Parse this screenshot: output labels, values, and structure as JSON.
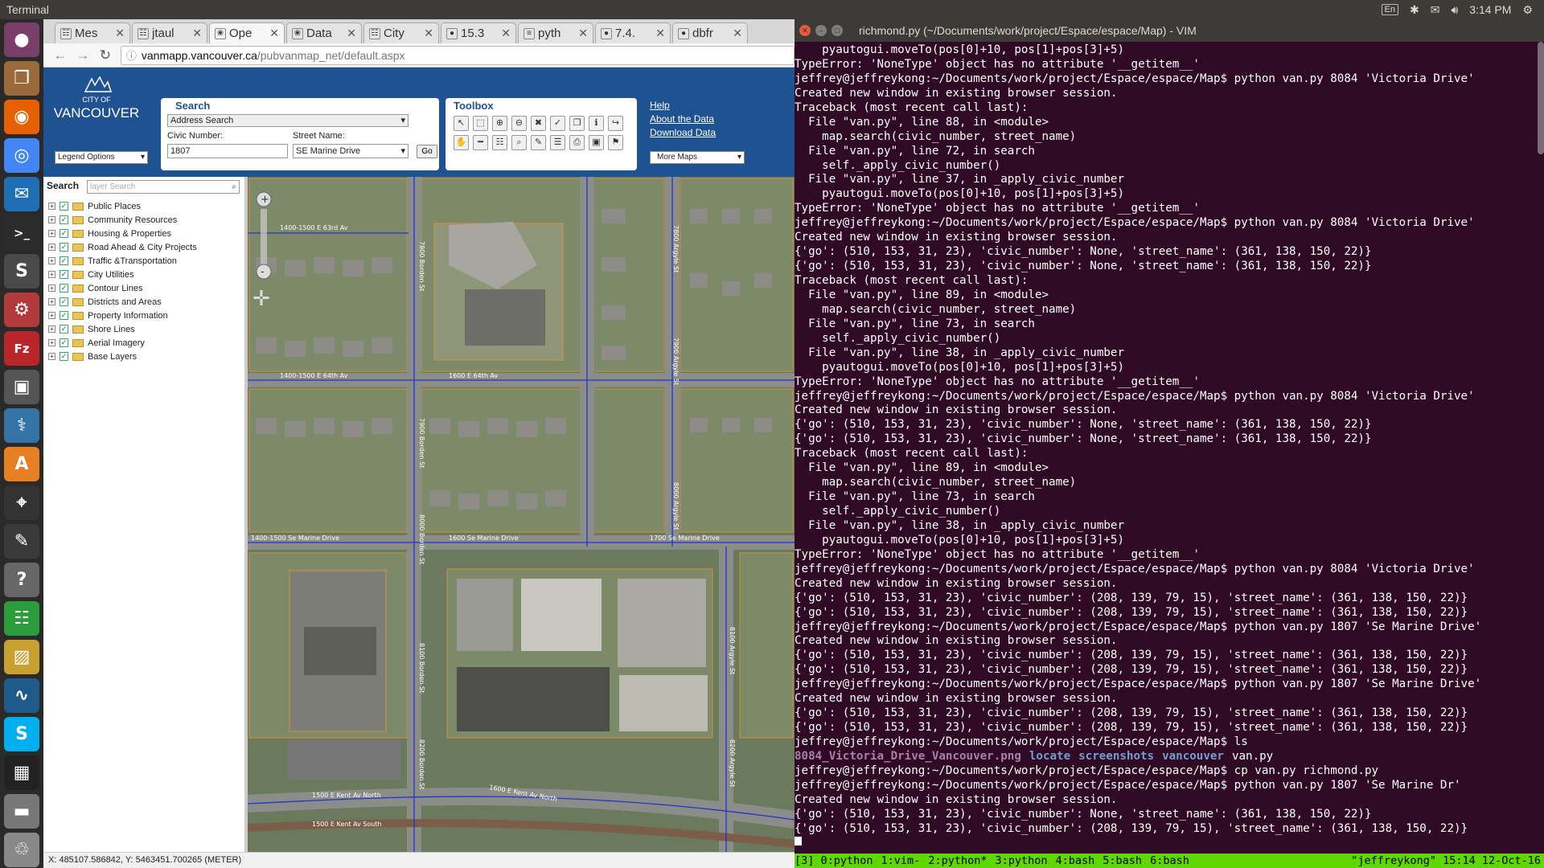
{
  "topbar": {
    "title": "Terminal",
    "keyboard": "En",
    "time": "3:14 PM"
  },
  "launcher": [
    "ubuntu-icon",
    "files-icon",
    "firefox-icon",
    "chrome-icon",
    "thunderbird-icon",
    "terminal-icon",
    "sublime-icon",
    "settings-icon",
    "filezilla-icon",
    "camera-icon",
    "python-icon",
    "software-icon",
    "screenshot-icon",
    "writer-icon",
    "help-icon",
    "spreadsheet-icon",
    "image-viewer-icon",
    "plot-icon",
    "skype-icon",
    "workspace-icon",
    "drive-icon",
    "trash-icon"
  ],
  "browser": {
    "tabs": [
      {
        "label": "Mes",
        "icon": "grid"
      },
      {
        "label": "jtaul",
        "icon": "doc"
      },
      {
        "label": "Ope",
        "icon": "leaf"
      },
      {
        "label": "Data",
        "icon": "leaf"
      },
      {
        "label": "City",
        "icon": "doc"
      },
      {
        "label": "15.3",
        "icon": "py"
      },
      {
        "label": "pyth",
        "icon": "so"
      },
      {
        "label": "7.4.",
        "icon": "py"
      },
      {
        "label": "dbfr",
        "icon": "py"
      }
    ],
    "url_domain": "vanmapp.vancouver.ca",
    "url_path": "/pubvanmap_net/default.aspx"
  },
  "vanmap": {
    "logo_top": "CITY OF",
    "logo_name": "VANCOUVER",
    "legend_options": "Legend Options",
    "search": {
      "title": "Search",
      "type": "Address Search",
      "civic_label": "Civic Number:",
      "civic_value": "1807",
      "street_label": "Street Name:",
      "street_value": "SE Marine Drive",
      "go": "Go"
    },
    "toolbox": {
      "title": "Toolbox"
    },
    "links": [
      "Help",
      "About the Data",
      "Download Data"
    ],
    "more_maps": "More Maps",
    "layer_search_label": "Search",
    "layer_search_placeholder": "layer Search",
    "layers": [
      "Public Places",
      "Community Resources",
      "Housing & Properties",
      "Road Ahead & City Projects",
      "Traffic &Transportation",
      "City Utilities",
      "Contour Lines",
      "Districts and Areas",
      "Property Information",
      "Shore Lines",
      "Aerial Imagery",
      "Base Layers"
    ],
    "map_streets": [
      "1400-1500 E 63rd Av",
      "1400-1500 E 64th Av",
      "1600 E 64th Av",
      "1400-1500 Se Marine Drive",
      "1600 Se Marine Drive",
      "1700 Se Marine Drive",
      "1500 E Kent Av North",
      "1600 E Kent Av North",
      "1500 E Kent Av South",
      "7800 Borden St",
      "7900 Borden St",
      "8000 Borden St",
      "8100 Borden St",
      "8200 Borden St",
      "7800 Argyle St",
      "7900 Argyle St",
      "8000 Argyle St",
      "8100 Argyle St",
      "8200 Argyle St"
    ],
    "coords": "X: 485107.586842, Y: 5463451.700265 (METER)"
  },
  "terminal": {
    "title": "richmond.py (~/Documents/work/project/Espace/espace/Map) - VIM",
    "lines": [
      "    pyautogui.moveTo(pos[0]+10, pos[1]+pos[3]+5)",
      "TypeError: 'NoneType' object has no attribute '__getitem__'",
      "jeffrey@jeffreykong:~/Documents/work/project/Espace/espace/Map$ python van.py 8084 'Victoria Drive'",
      "Created new window in existing browser session.",
      "Traceback (most recent call last):",
      "  File \"van.py\", line 88, in <module>",
      "    map.search(civic_number, street_name)",
      "  File \"van.py\", line 72, in search",
      "    self._apply_civic_number()",
      "  File \"van.py\", line 37, in _apply_civic_number",
      "    pyautogui.moveTo(pos[0]+10, pos[1]+pos[3]+5)",
      "TypeError: 'NoneType' object has no attribute '__getitem__'",
      "jeffrey@jeffreykong:~/Documents/work/project/Espace/espace/Map$ python van.py 8084 'Victoria Drive'",
      "Created new window in existing browser session.",
      "{'go': (510, 153, 31, 23), 'civic_number': None, 'street_name': (361, 138, 150, 22)}",
      "{'go': (510, 153, 31, 23), 'civic_number': None, 'street_name': (361, 138, 150, 22)}",
      "Traceback (most recent call last):",
      "  File \"van.py\", line 89, in <module>",
      "    map.search(civic_number, street_name)",
      "  File \"van.py\", line 73, in search",
      "    self._apply_civic_number()",
      "  File \"van.py\", line 38, in _apply_civic_number",
      "    pyautogui.moveTo(pos[0]+10, pos[1]+pos[3]+5)",
      "TypeError: 'NoneType' object has no attribute '__getitem__'",
      "jeffrey@jeffreykong:~/Documents/work/project/Espace/espace/Map$ python van.py 8084 'Victoria Drive'",
      "Created new window in existing browser session.",
      "{'go': (510, 153, 31, 23), 'civic_number': None, 'street_name': (361, 138, 150, 22)}",
      "{'go': (510, 153, 31, 23), 'civic_number': None, 'street_name': (361, 138, 150, 22)}",
      "Traceback (most recent call last):",
      "  File \"van.py\", line 89, in <module>",
      "    map.search(civic_number, street_name)",
      "  File \"van.py\", line 73, in search",
      "    self._apply_civic_number()",
      "  File \"van.py\", line 38, in _apply_civic_number",
      "    pyautogui.moveTo(pos[0]+10, pos[1]+pos[3]+5)",
      "TypeError: 'NoneType' object has no attribute '__getitem__'",
      "jeffrey@jeffreykong:~/Documents/work/project/Espace/espace/Map$ python van.py 8084 'Victoria Drive'",
      "Created new window in existing browser session.",
      "{'go': (510, 153, 31, 23), 'civic_number': (208, 139, 79, 15), 'street_name': (361, 138, 150, 22)}",
      "{'go': (510, 153, 31, 23), 'civic_number': (208, 139, 79, 15), 'street_name': (361, 138, 150, 22)}",
      "jeffrey@jeffreykong:~/Documents/work/project/Espace/espace/Map$ python van.py 1807 'Se Marine Drive'",
      "Created new window in existing browser session.",
      "{'go': (510, 153, 31, 23), 'civic_number': (208, 139, 79, 15), 'street_name': (361, 138, 150, 22)}",
      "{'go': (510, 153, 31, 23), 'civic_number': (208, 139, 79, 15), 'street_name': (361, 138, 150, 22)}",
      "jeffrey@jeffreykong:~/Documents/work/project/Espace/espace/Map$ python van.py 1807 'Se Marine Drive'",
      "Created new window in existing browser session.",
      "{'go': (510, 153, 31, 23), 'civic_number': (208, 139, 79, 15), 'street_name': (361, 138, 150, 22)}",
      "{'go': (510, 153, 31, 23), 'civic_number': (208, 139, 79, 15), 'street_name': (361, 138, 150, 22)}",
      "jeffrey@jeffreykong:~/Documents/work/project/Espace/espace/Map$ ls"
    ],
    "ls_output": [
      {
        "name": "8084_Victoria_Drive_Vancouver.png",
        "kind": "img"
      },
      {
        "name": "locate",
        "kind": "d"
      },
      {
        "name": "screenshots",
        "kind": "d"
      },
      {
        "name": "vancouver",
        "kind": "d"
      },
      {
        "name": "van.py",
        "kind": "f"
      }
    ],
    "lines_after": [
      "jeffrey@jeffreykong:~/Documents/work/project/Espace/espace/Map$ cp van.py richmond.py",
      "jeffrey@jeffreykong:~/Documents/work/project/Espace/espace/Map$ python van.py 1807 'Se Marine Dr'",
      "Created new window in existing browser session.",
      "{'go': (510, 153, 31, 23), 'civic_number': None, 'street_name': (361, 138, 150, 22)}",
      "{'go': (510, 153, 31, 23), 'civic_number': (208, 139, 79, 15), 'street_name': (361, 138, 150, 22)}"
    ],
    "tmux_windows": [
      "[3] 0:python",
      "1:vim-",
      "2:python*",
      "3:python",
      "4:bash",
      "5:bash",
      "6:bash"
    ],
    "tmux_right": "\"jeffreykong\" 15:14 12-Oct-16"
  }
}
